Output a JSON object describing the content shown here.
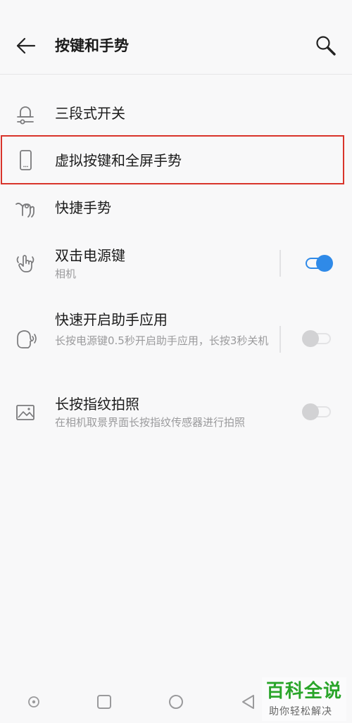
{
  "header": {
    "title": "按键和手势"
  },
  "items": [
    {
      "title": "三段式开关",
      "icon": "alert-slider-icon"
    },
    {
      "title": "虚拟按键和全屏手势",
      "icon": "phone-icon"
    },
    {
      "title": "快捷手势",
      "icon": "gesture-icon"
    },
    {
      "title": "双击电源键",
      "subtitle": "相机",
      "icon": "double-tap-icon",
      "toggle": "on"
    },
    {
      "title": "快速开启助手应用",
      "subtitle": "长按电源键0.5秒开启助手应用，长按3秒关机",
      "icon": "assistant-icon",
      "toggle": "off"
    },
    {
      "title": "长按指纹拍照",
      "subtitle": "在相机取景界面长按指纹传感器进行拍照",
      "icon": "image-icon",
      "toggle": "off"
    }
  ],
  "watermark": {
    "main": "百科全说",
    "sub": "助你轻松解决"
  },
  "colors": {
    "accent": "#2f8ae8",
    "highlight": "#d9342b",
    "watermark": "#2aa52a"
  }
}
